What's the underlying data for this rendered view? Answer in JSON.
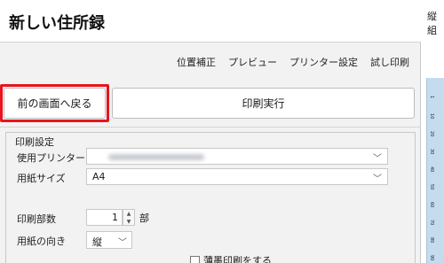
{
  "window": {
    "title": "新しい住所録"
  },
  "menu": [
    "位置補正",
    "プレビュー",
    "プリンター設定",
    "試し印刷"
  ],
  "buttons": {
    "back": "前の画面へ戻る",
    "print": "印刷実行"
  },
  "settings": {
    "title": "印刷設定",
    "printer": {
      "label": "使用プリンター",
      "value": ""
    },
    "paper_size": {
      "label": "用紙サイズ",
      "value": "A4"
    },
    "copies": {
      "label": "印刷部数",
      "value": "1",
      "unit": "部"
    },
    "orientation": {
      "label": "用紙の向き",
      "value": "縦"
    },
    "light_ink": {
      "label": "薄墨印刷をする",
      "checked": false
    }
  },
  "side_panel": {
    "label": "縦組",
    "ruler_ticks": [
      "1",
      "10",
      "20",
      "30",
      "40",
      "50",
      "60",
      "70",
      "80",
      "90"
    ]
  },
  "colors": {
    "highlight": "#e8141e",
    "ruler": "#c5dbee"
  }
}
